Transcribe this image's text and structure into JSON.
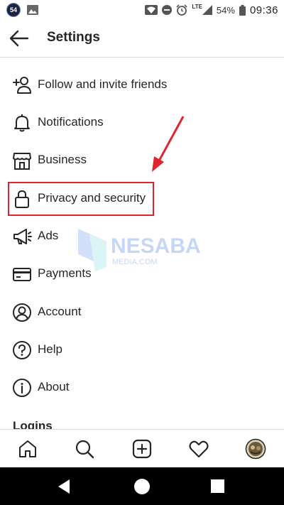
{
  "status_bar": {
    "badge": "54",
    "network": "LTE",
    "battery": "54%",
    "time": "09:36"
  },
  "header": {
    "title": "Settings"
  },
  "menu": {
    "items": [
      {
        "label": "Follow and invite friends",
        "icon": "add-person-icon"
      },
      {
        "label": "Notifications",
        "icon": "bell-icon"
      },
      {
        "label": "Business",
        "icon": "storefront-icon"
      },
      {
        "label": "Privacy and security",
        "icon": "lock-icon"
      },
      {
        "label": "Ads",
        "icon": "megaphone-icon"
      },
      {
        "label": "Payments",
        "icon": "card-icon"
      },
      {
        "label": "Account",
        "icon": "person-circle-icon"
      },
      {
        "label": "Help",
        "icon": "question-circle-icon"
      },
      {
        "label": "About",
        "icon": "info-circle-icon"
      }
    ],
    "section_logins": "Logins"
  },
  "watermark": {
    "brand": "NESABA",
    "sub": "MEDIA.COM"
  },
  "colors": {
    "highlight": "#e0252e",
    "text": "#262626"
  }
}
